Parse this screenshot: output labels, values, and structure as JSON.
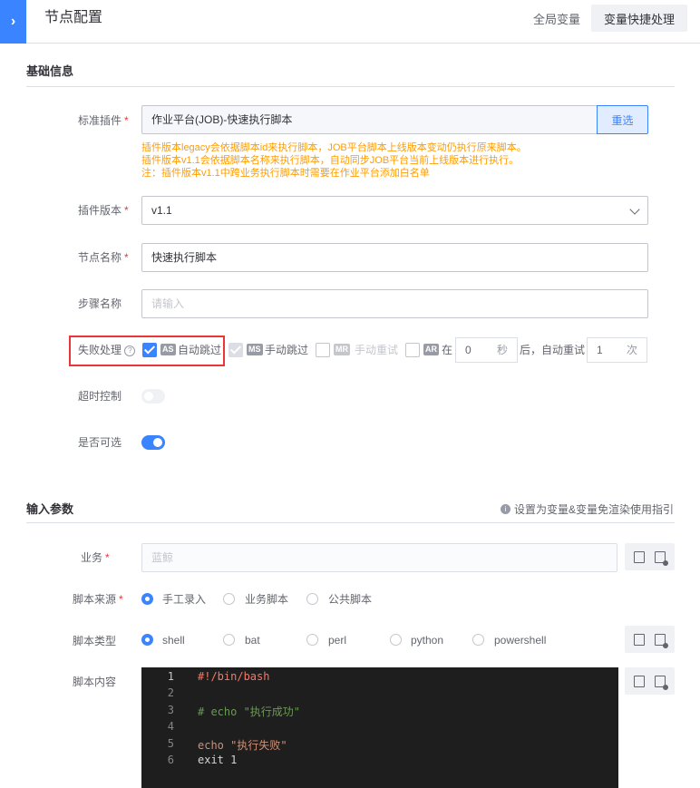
{
  "header": {
    "title": "节点配置",
    "global_var": "全局变量",
    "var_quick": "变量快捷处理"
  },
  "basic": {
    "title": "基础信息",
    "plugin": {
      "label": "标准插件",
      "value": "作业平台(JOB)-快速执行脚本",
      "reselect": "重选",
      "tips": [
        "插件版本legacy会依据脚本id来执行脚本，JOB平台脚本上线版本变动仍执行原来脚本。",
        "插件版本v1.1会依据脚本名称来执行脚本，自动同步JOB平台当前上线版本进行执行。",
        "注：插件版本v1.1中跨业务执行脚本时需要在作业平台添加白名单"
      ]
    },
    "version": {
      "label": "插件版本",
      "value": "v1.1"
    },
    "node_name": {
      "label": "节点名称",
      "value": "快速执行脚本"
    },
    "step_name": {
      "label": "步骤名称",
      "placeholder": "请输入"
    },
    "failure": {
      "label": "失败处理",
      "auto_skip": {
        "tag": "AS",
        "text": "自动跳过",
        "checked": true
      },
      "manual_skip": {
        "tag": "MS",
        "text": "手动跳过"
      },
      "manual_retry": {
        "tag": "MR",
        "text": "手动重试"
      },
      "auto_retry": {
        "tag": "AR",
        "prefix": "在",
        "seconds": "0",
        "seconds_unit": "秒",
        "middle": "后，自动重试",
        "times": "1",
        "times_unit": "次"
      }
    },
    "timeout": {
      "label": "超时控制",
      "on": false
    },
    "optional": {
      "label": "是否可选",
      "on": true
    }
  },
  "input": {
    "title": "输入参数",
    "help": "设置为变量&变量免渲染使用指引",
    "business": {
      "label": "业务",
      "placeholder": "蓝鲸"
    },
    "script_source": {
      "label": "脚本来源",
      "options": [
        "手工录入",
        "业务脚本",
        "公共脚本"
      ],
      "selected": 0
    },
    "script_type": {
      "label": "脚本类型",
      "options": [
        "shell",
        "bat",
        "perl",
        "python",
        "powershell"
      ],
      "selected": 0
    },
    "script_content": {
      "label": "脚本内容",
      "lines": [
        "#!/bin/bash",
        "",
        "# echo \"执行成功\"",
        "",
        "echo \"执行失败\"",
        "exit 1"
      ],
      "line_numbers": [
        "1",
        "2",
        "3",
        "4",
        "5",
        "6"
      ]
    }
  },
  "colors": {
    "primary": "#3a84ff",
    "danger": "#ea3636",
    "warning": "#ff9c01",
    "editor_bg": "#1e1e1e"
  }
}
